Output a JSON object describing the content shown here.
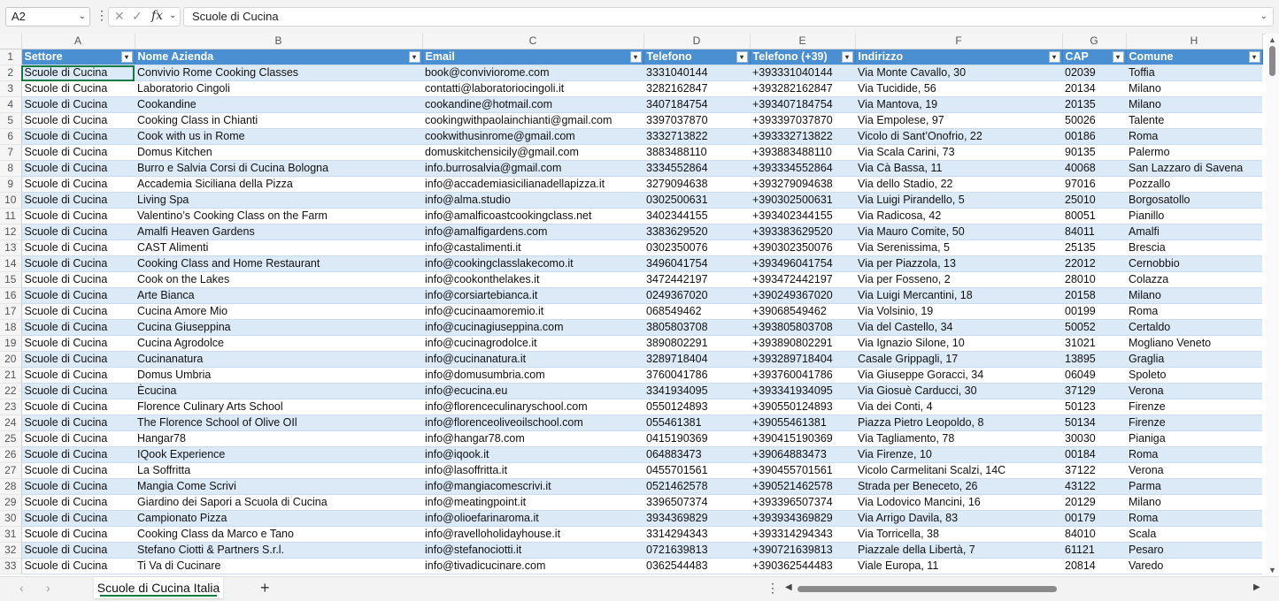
{
  "formula_bar": {
    "name_box": "A2",
    "fx": "fx",
    "value": "Scuole di Cucina"
  },
  "columns": [
    "A",
    "B",
    "C",
    "D",
    "E",
    "F",
    "G",
    "H"
  ],
  "headers": [
    "Settore",
    "Nome Azienda",
    "Email",
    "Telefono",
    "Telefono (+39)",
    "Indirizzo",
    "CAP",
    "Comune"
  ],
  "rows": [
    [
      "Scuole di Cucina",
      "Convivio Rome Cooking Classes",
      "book@conviviorome.com",
      "3331040144",
      "+393331040144",
      "Via Monte Cavallo, 30",
      "02039",
      "Toffia"
    ],
    [
      "Scuole di Cucina",
      "Laboratorio Cingoli",
      "contatti@laboratoriocingoli.it",
      "3282162847",
      "+393282162847",
      "Via Tucidide, 56",
      "20134",
      "Milano"
    ],
    [
      "Scuole di Cucina",
      "Cookandine",
      "cookandine@hotmail.com",
      "3407184754",
      "+393407184754",
      "Via Mantova, 19",
      "20135",
      "Milano"
    ],
    [
      "Scuole di Cucina",
      "Cooking Class in Chianti",
      "cookingwithpaolainchianti@gmail.com",
      "3397037870",
      "+393397037870",
      "Via Empolese, 97",
      "50026",
      "Talente"
    ],
    [
      "Scuole di Cucina",
      "Cook with us in Rome",
      "cookwithusinrome@gmail.com",
      "3332713822",
      "+393332713822",
      "Vicolo di Sant’Onofrio, 22",
      "00186",
      "Roma"
    ],
    [
      "Scuole di Cucina",
      "Domus Kitchen",
      "domuskitchensicily@gmail.com",
      "3883488110",
      "+393883488110",
      "Via Scala Carini, 73",
      "90135",
      "Palermo"
    ],
    [
      "Scuole di Cucina",
      "Burro e Salvia Corsi di Cucina Bologna",
      "info.burrosalvia@gmail.com",
      "3334552864",
      "+393334552864",
      "Via Cà Bassa, 11",
      "40068",
      "San Lazzaro di Savena"
    ],
    [
      "Scuole di Cucina",
      "Accademia Siciliana della Pizza",
      "info@accademiasicilianadellapizza.it",
      "3279094638",
      "+393279094638",
      "Via dello Stadio, 22",
      "97016",
      "Pozzallo"
    ],
    [
      "Scuole di Cucina",
      "Living Spa",
      "info@alma.studio",
      "0302500631",
      "+390302500631",
      "Via Luigi Pirandello, 5",
      "25010",
      "Borgosatollo"
    ],
    [
      "Scuole di Cucina",
      "Valentino’s Cooking Class on the Farm",
      "info@amalficoastcookingclass.net",
      "3402344155",
      "+393402344155",
      "Via Radicosa, 42",
      "80051",
      "Pianillo"
    ],
    [
      "Scuole di Cucina",
      "Amalfi Heaven Gardens",
      "info@amalfigardens.com",
      "3383629520",
      "+393383629520",
      "Via Mauro Comite, 50",
      "84011",
      "Amalfi"
    ],
    [
      "Scuole di Cucina",
      "CAST Alimenti",
      "info@castalimenti.it",
      "0302350076",
      "+390302350076",
      "Via Serenissima, 5",
      "25135",
      "Brescia"
    ],
    [
      "Scuole di Cucina",
      "Cooking Class and Home Restaurant",
      "info@cookingclasslakecomo.it",
      "3496041754",
      "+393496041754",
      "Via per Piazzola, 13",
      "22012",
      "Cernobbio"
    ],
    [
      "Scuole di Cucina",
      "Cook on the Lakes",
      "info@cookonthelakes.it",
      "3472442197",
      "+393472442197",
      "Via per Fosseno, 2",
      "28010",
      "Colazza"
    ],
    [
      "Scuole di Cucina",
      "Arte Bianca",
      "info@corsiartebianca.it",
      "0249367020",
      "+390249367020",
      "Via Luigi Mercantini, 18",
      "20158",
      "Milano"
    ],
    [
      "Scuole di Cucina",
      "Cucina Amore Mio",
      "info@cucinaamoremio.it",
      "068549462",
      "+39068549462",
      "Via Volsinio, 19",
      "00199",
      "Roma"
    ],
    [
      "Scuole di Cucina",
      "Cucina Giuseppina",
      "info@cucinagiuseppina.com",
      "3805803708",
      "+393805803708",
      "Via del Castello, 34",
      "50052",
      "Certaldo"
    ],
    [
      "Scuole di Cucina",
      "Cucina Agrodolce",
      "info@cucinagrodolce.it",
      "3890802291",
      "+393890802291",
      "Via Ignazio Silone, 10",
      "31021",
      "Mogliano Veneto"
    ],
    [
      "Scuole di Cucina",
      "Cucinanatura",
      "info@cucinanatura.it",
      "3289718404",
      "+393289718404",
      "Casale Grippagli, 17",
      "13895",
      "Graglia"
    ],
    [
      "Scuole di Cucina",
      "Domus Umbria",
      "info@domusumbria.com",
      "3760041786",
      "+393760041786",
      "Via Giuseppe Goracci, 34",
      "06049",
      "Spoleto"
    ],
    [
      "Scuole di Cucina",
      "Ècucina",
      "info@ecucina.eu",
      "3341934095",
      "+393341934095",
      "Via Giosuè Carducci, 30",
      "37129",
      "Verona"
    ],
    [
      "Scuole di Cucina",
      "Florence Culinary Arts School",
      "info@florenceculinaryschool.com",
      "0550124893",
      "+390550124893",
      "Via dei Conti, 4",
      "50123",
      "Firenze"
    ],
    [
      "Scuole di Cucina",
      "The Florence School of Olive OIl",
      "info@florenceoliveoilschool.com",
      "055461381",
      "+39055461381",
      "Piazza Pietro Leopoldo, 8",
      "50134",
      "Firenze"
    ],
    [
      "Scuole di Cucina",
      "Hangar78",
      "info@hangar78.com",
      "0415190369",
      "+390415190369",
      "Via Tagliamento, 78",
      "30030",
      "Pianiga"
    ],
    [
      "Scuole di Cucina",
      "IQook Experience",
      "info@iqook.it",
      "064883473",
      "+39064883473",
      "Via Firenze, 10",
      "00184",
      "Roma"
    ],
    [
      "Scuole di Cucina",
      "La Soffritta",
      "info@lasoffritta.it",
      "0455701561",
      "+390455701561",
      "Vicolo Carmelitani Scalzi, 14C",
      "37122",
      "Verona"
    ],
    [
      "Scuole di Cucina",
      "Mangia Come Scrivi",
      "info@mangiacomescrivi.it",
      "0521462578",
      "+390521462578",
      "Strada per Beneceto, 26",
      "43122",
      "Parma"
    ],
    [
      "Scuole di Cucina",
      "Giardino dei Sapori a Scuola di Cucina",
      "info@meatingpoint.it",
      "3396507374",
      "+393396507374",
      "Via Lodovico Mancini, 16",
      "20129",
      "Milano"
    ],
    [
      "Scuole di Cucina",
      "Campionato Pizza",
      "info@olioefarinaroma.it",
      "3934369829",
      "+393934369829",
      "Via Arrigo Davila, 83",
      "00179",
      "Roma"
    ],
    [
      "Scuole di Cucina",
      "Cooking Class da Marco e Tano",
      "info@ravelloholidayhouse.it",
      "3314294343",
      "+393314294343",
      "Via Torricella, 38",
      "84010",
      "Scala"
    ],
    [
      "Scuole di Cucina",
      "Stefano Ciotti & Partners S.r.l.",
      "info@stefanociotti.it",
      "0721639813",
      "+390721639813",
      "Piazzale della Libertà, 7",
      "61121",
      "Pesaro"
    ],
    [
      "Scuole di Cucina",
      "Ti Va di Cucinare",
      "info@tivadicucinare.com",
      "0362544483",
      "+390362544483",
      "Viale Europa, 11",
      "20814",
      "Varedo"
    ]
  ],
  "sheet_tabs": [
    "Scuole di Cucina Italia"
  ],
  "icons": {
    "filter": "chevron-down-icon",
    "add_sheet": "plus-icon"
  },
  "colors": {
    "header_fill": "#4a8fd1",
    "band_fill": "#dce9f7",
    "accent": "#107c41"
  }
}
